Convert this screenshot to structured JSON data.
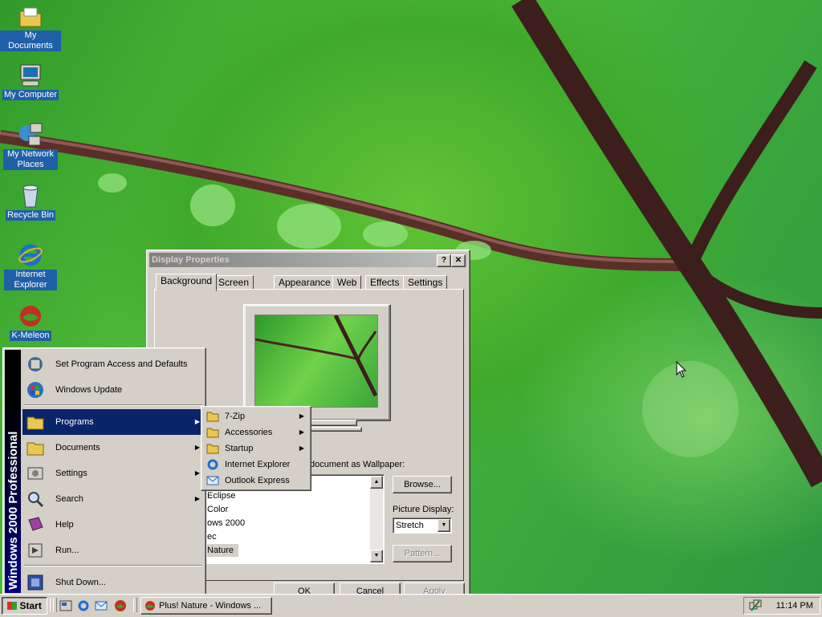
{
  "desktop": {
    "icons": [
      {
        "label": "My Documents"
      },
      {
        "label": "My Computer"
      },
      {
        "label": "My Network Places"
      },
      {
        "label": "Recycle Bin"
      },
      {
        "label": "Internet Explorer"
      },
      {
        "label": "K-Meleon"
      }
    ]
  },
  "dialog": {
    "title": "Display Properties",
    "help_glyph": "?",
    "close_glyph": "✕",
    "tabs": [
      "Background",
      "Screen Saver",
      "Appearance",
      "Web",
      "Effects",
      "Settings"
    ],
    "wallpaper_label": "document as Wallpaper:",
    "wallpaper_items": [
      "Eclipse",
      "Color",
      "ows 2000",
      "ec",
      "Nature"
    ],
    "selected_wallpaper": "Nature",
    "browse_label": "Browse...",
    "picture_display_label": "Picture Display:",
    "picture_display_value": "Stretch",
    "pattern_label": "Pattern...",
    "ok_label": "OK",
    "cancel_label": "Cancel",
    "apply_label": "Apply"
  },
  "start_menu": {
    "band_text": "Windows 2000 Professional",
    "items": [
      {
        "label": "Set Program Access and Defaults",
        "icon": "program-access-icon"
      },
      {
        "label": "Windows Update",
        "icon": "windows-update-icon"
      },
      {
        "label": "Programs",
        "icon": "programs-folder-icon",
        "submenu": true
      },
      {
        "label": "Documents",
        "icon": "documents-folder-icon",
        "submenu": true
      },
      {
        "label": "Settings",
        "icon": "settings-icon",
        "submenu": true
      },
      {
        "label": "Search",
        "icon": "search-icon",
        "submenu": true
      },
      {
        "label": "Help",
        "icon": "help-book-icon"
      },
      {
        "label": "Run...",
        "icon": "run-icon"
      },
      {
        "label": "Shut Down...",
        "icon": "shutdown-icon"
      }
    ],
    "selected": "Programs"
  },
  "programs_submenu": {
    "items": [
      {
        "label": "7-Zip",
        "submenu": true
      },
      {
        "label": "Accessories",
        "submenu": true
      },
      {
        "label": "Startup",
        "submenu": true
      },
      {
        "label": "Internet Explorer"
      },
      {
        "label": "Outlook Express"
      }
    ]
  },
  "taskbar": {
    "start_label": "Start",
    "task_label": "Plus! Nature - Windows ...",
    "clock": "11:14 PM"
  }
}
